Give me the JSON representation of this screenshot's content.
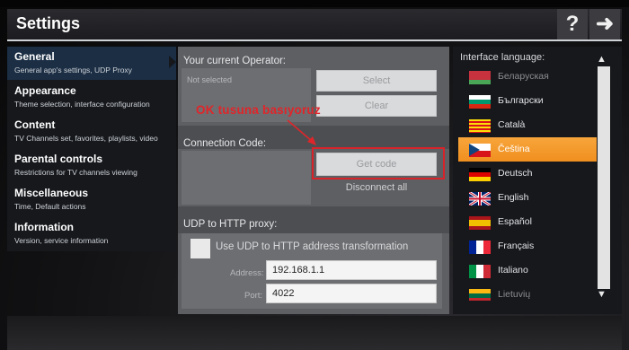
{
  "header": {
    "title": "Settings",
    "help_icon": "?",
    "next_icon": "➜"
  },
  "nav": [
    {
      "title": "General",
      "subtitle": "General app's settings, UDP Proxy",
      "active": true
    },
    {
      "title": "Appearance",
      "subtitle": "Theme selection, interface configuration",
      "active": false
    },
    {
      "title": "Content",
      "subtitle": "TV Channels set, favorites, playlists, video",
      "active": false
    },
    {
      "title": "Parental controls",
      "subtitle": "Restrictions for TV channels viewing",
      "active": false
    },
    {
      "title": "Miscellaneous",
      "subtitle": "Time, Default actions",
      "active": false
    },
    {
      "title": "Information",
      "subtitle": "Version, service information",
      "active": false
    }
  ],
  "operator": {
    "label": "Your current Operator:",
    "value": "Not selected",
    "select_label": "Select",
    "clear_label": "Clear"
  },
  "annotation": {
    "text": "OK tusuna basıyoruz",
    "color": "#e0252a"
  },
  "connection": {
    "label": "Connection Code:",
    "get_code_label": "Get code",
    "disconnect_label": "Disconnect all"
  },
  "udp": {
    "label": "UDP to HTTP proxy:",
    "checkbox_label": "Use UDP to HTTP address transformation",
    "address_label": "Address:",
    "address_value": "192.168.1.1",
    "port_label": "Port:",
    "port_value": "4022"
  },
  "languages": {
    "label": "Interface language:",
    "items": [
      {
        "name": "Беларуская",
        "flag": "belarus-flag-icon",
        "selected": false,
        "dim": true
      },
      {
        "name": "Български",
        "flag": "bulgaria-flag-icon",
        "selected": false,
        "dim": false
      },
      {
        "name": "Català",
        "flag": "catalonia-flag-icon",
        "selected": false,
        "dim": false
      },
      {
        "name": "Čeština",
        "flag": "czech-flag-icon",
        "selected": true,
        "dim": false
      },
      {
        "name": "Deutsch",
        "flag": "germany-flag-icon",
        "selected": false,
        "dim": false
      },
      {
        "name": "English",
        "flag": "uk-flag-icon",
        "selected": false,
        "dim": false
      },
      {
        "name": "Español",
        "flag": "spain-flag-icon",
        "selected": false,
        "dim": false
      },
      {
        "name": "Français",
        "flag": "france-flag-icon",
        "selected": false,
        "dim": false
      },
      {
        "name": "Italiano",
        "flag": "italy-flag-icon",
        "selected": false,
        "dim": false
      },
      {
        "name": "Lietuvių",
        "flag": "lithuania-flag-icon",
        "selected": false,
        "dim": true
      }
    ]
  },
  "colors": {
    "accent": "#f39a2a",
    "active_nav": "#1b2e44",
    "annotation": "#e0252a"
  }
}
